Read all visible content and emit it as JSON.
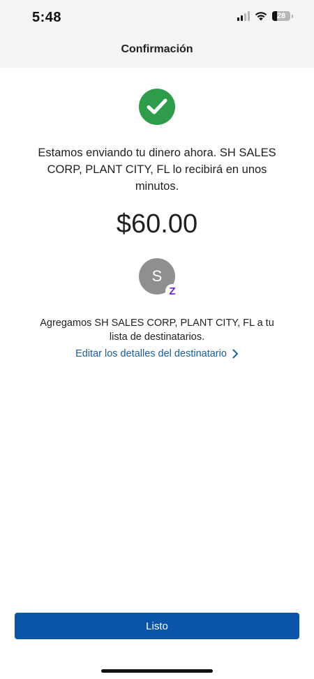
{
  "status_bar": {
    "time": "5:48",
    "battery": "28",
    "battery_level": 0.28,
    "icons": [
      "signal-icon",
      "wifi-icon",
      "battery-icon"
    ]
  },
  "header": {
    "title": "Confirmación"
  },
  "confirmation": {
    "icon": "check-circle-icon",
    "message": "Estamos enviando tu dinero ahora. SH SALES CORP, PLANT CITY, FL lo recibirá en unos minutos.",
    "amount": "$60.00"
  },
  "recipient": {
    "avatar_initial": "S",
    "badge_icon": "zelle-icon",
    "badge_glyph": "Z",
    "added_message": "Agregamos SH SALES CORP, PLANT CITY, FL a tu lista de destinatarios.",
    "edit_link_label": "Editar los detalles del destinatario"
  },
  "footer": {
    "done_label": "Listo"
  },
  "colors": {
    "success": "#2e9c4a",
    "primary_button": "#0a55a8",
    "link": "#1b5d9b",
    "zelle_purple": "#6d1ed4",
    "avatar_bg": "#8f8f8f",
    "header_bg": "#f3f4f6"
  }
}
